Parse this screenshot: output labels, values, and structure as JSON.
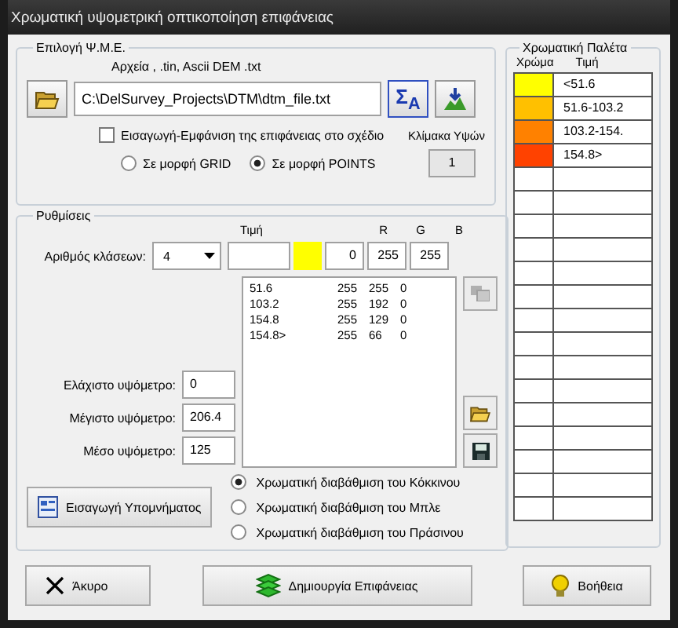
{
  "window": {
    "title": "Χρωματική υψομετρική οπτικοποίηση επιφάνειας"
  },
  "dem": {
    "title": "Επιλογή Ψ.Μ.Ε.",
    "file_types": "Αρχεία , .tin,  Ascii DEM .txt",
    "file_path": "C:\\DelSurvey_Projects\\DTM\\dtm_file.txt",
    "sigma_button": "Σ$_{A}$",
    "checkbox": {
      "label": "Εισαγωγή-Εμφάνιση της επιφάνειας στο σχέδιο",
      "checked": false
    },
    "scale_label": "Κλίμακα Υψών",
    "scale_value": "1",
    "formats": [
      {
        "label": "Σε μορφή GRID",
        "selected": false
      },
      {
        "label": "Σε μορφή POINTS",
        "selected": true
      }
    ]
  },
  "settings": {
    "title": "Ρυθμίσεις",
    "value_header": "Τιμή",
    "r_header": "R",
    "g_header": "G",
    "b_header": "B",
    "classes_label": "Αριθμός κλάσεων:",
    "classes_value": "4",
    "edit": {
      "color": "#ffff00",
      "r": "0",
      "g": "255",
      "b": "255"
    },
    "list": [
      {
        "value": "51.6",
        "r": "255",
        "g": "255",
        "b": "0"
      },
      {
        "value": "103.2",
        "r": "255",
        "g": "192",
        "b": "0"
      },
      {
        "value": "154.8",
        "r": "255",
        "g": "129",
        "b": "0"
      },
      {
        "value": "154.8>",
        "r": "255",
        "g": "66",
        "b": "0"
      }
    ],
    "min_label": "Ελάχιστο υψόμετρο:",
    "min_value": "0",
    "max_label": "Μέγιστο υψόμετρο:",
    "max_value": "206.4",
    "mean_label": "Μέσο υψόμετρο:",
    "mean_value": "125",
    "legend_button": "Εισαγωγή Υπομνήματος",
    "gradients": [
      {
        "label": "Χρωματική διαβάθμιση του Κόκκινου",
        "selected": true
      },
      {
        "label": "Χρωματική διαβάθμιση του Μπλε",
        "selected": false
      },
      {
        "label": "Χρωματική διαβάθμιση του Πράσινου",
        "selected": false
      }
    ]
  },
  "palette": {
    "title": "Χρωματική Παλέτα",
    "color_header": "Χρώμα",
    "value_header": "Τιμή",
    "rows": [
      {
        "color": "#ffff00",
        "value": "<51.6"
      },
      {
        "color": "#ffc000",
        "value": "51.6-103.2"
      },
      {
        "color": "#ff8100",
        "value": "103.2-154."
      },
      {
        "color": "#ff4200",
        "value": "154.8>"
      }
    ]
  },
  "buttons": [
    {
      "kind": "cancel",
      "label": "Άκυρο"
    },
    {
      "kind": "create",
      "label": "Δημιουργία Επιφάνειας"
    },
    {
      "kind": "help",
      "label": "Βοήθεια"
    }
  ]
}
